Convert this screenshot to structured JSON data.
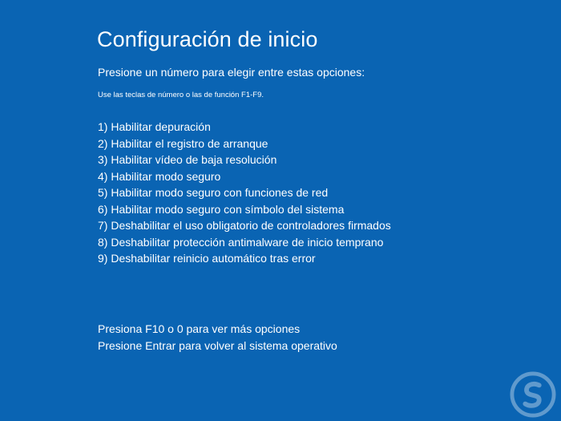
{
  "screen": {
    "title": "Configuración de inicio",
    "prompt": "Presione un número para elegir entre estas opciones:",
    "hint": "Use las teclas de número o las de función F1-F9.",
    "background_color": "#0a64b3",
    "text_color": "#ffffff"
  },
  "options": [
    {
      "label": "1) Habilitar depuración"
    },
    {
      "label": "2) Habilitar el registro de arranque"
    },
    {
      "label": "3) Habilitar vídeo de baja resolución"
    },
    {
      "label": "4) Habilitar modo seguro"
    },
    {
      "label": "5) Habilitar modo seguro con funciones de red"
    },
    {
      "label": "6) Habilitar modo seguro con símbolo del sistema"
    },
    {
      "label": "7) Deshabilitar el uso obligatorio de controladores firmados"
    },
    {
      "label": "8) Deshabilitar protección antimalware de inicio temprano"
    },
    {
      "label": "9) Deshabilitar reinicio automático tras error"
    }
  ],
  "footer": {
    "more_options": "Presiona F10 o 0 para ver más opciones",
    "return_os": "Presione Entrar para volver al sistema operativo"
  },
  "watermark": {
    "icon": "solvetic-logo-icon"
  }
}
